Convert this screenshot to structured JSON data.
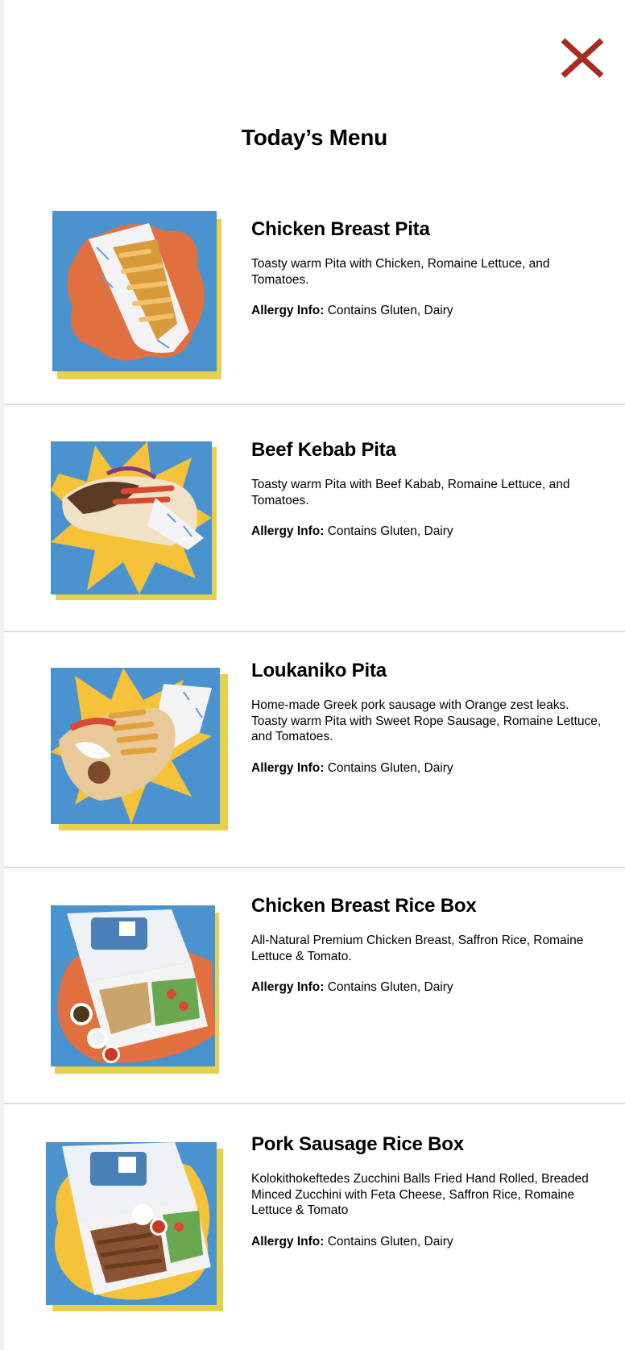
{
  "page": {
    "title": "Today’s Menu",
    "close_icon": "close-x-icon",
    "accent_color": "#a82a22"
  },
  "colors": {
    "photo_blue": "#4a93cf",
    "shadow_yellow": "#e5d14c",
    "blob_orange": "#e0703f",
    "blob_yellow": "#f5c23a"
  },
  "menu": {
    "allergy_label": "Allergy Info:",
    "items": [
      {
        "name": "Chicken Breast Pita",
        "description": "Toasty warm Pita with Chicken, Romaine Lettuce, and Tomatoes.",
        "allergy": "Contains Gluten, Dairy",
        "image": "chicken-pita-photo"
      },
      {
        "name": "Beef Kebab Pita",
        "description": "Toasty warm Pita with Beef Kabab, Romaine Lettuce, and Tomatoes.",
        "allergy": "Contains Gluten, Dairy",
        "image": "beef-kebab-pita-photo"
      },
      {
        "name": "Loukaniko Pita",
        "description": "Home-made Greek  pork sausage  with Orange zest leaks. Toasty warm Pita with Sweet Rope Sausage, Romaine Lettuce, and Tomatoes.",
        "allergy": "Contains Gluten, Dairy",
        "image": "loukaniko-pita-photo"
      },
      {
        "name": "Chicken Breast Rice Box",
        "description": "All-Natural Premium Chicken Breast, Saffron Rice, Romaine Lettuce & Tomato.",
        "allergy": "Contains Gluten, Dairy",
        "image": "chicken-rice-box-photo"
      },
      {
        "name": "Pork Sausage Rice Box",
        "description": "Kolokithokeftedes Zucchini Balls Fried Hand Rolled, Breaded Minced Zucchini with Feta Cheese, Saffron Rice, Romaine Lettuce & Tomato",
        "allergy": "Contains Gluten, Dairy",
        "image": "pork-sausage-rice-box-photo"
      }
    ]
  }
}
